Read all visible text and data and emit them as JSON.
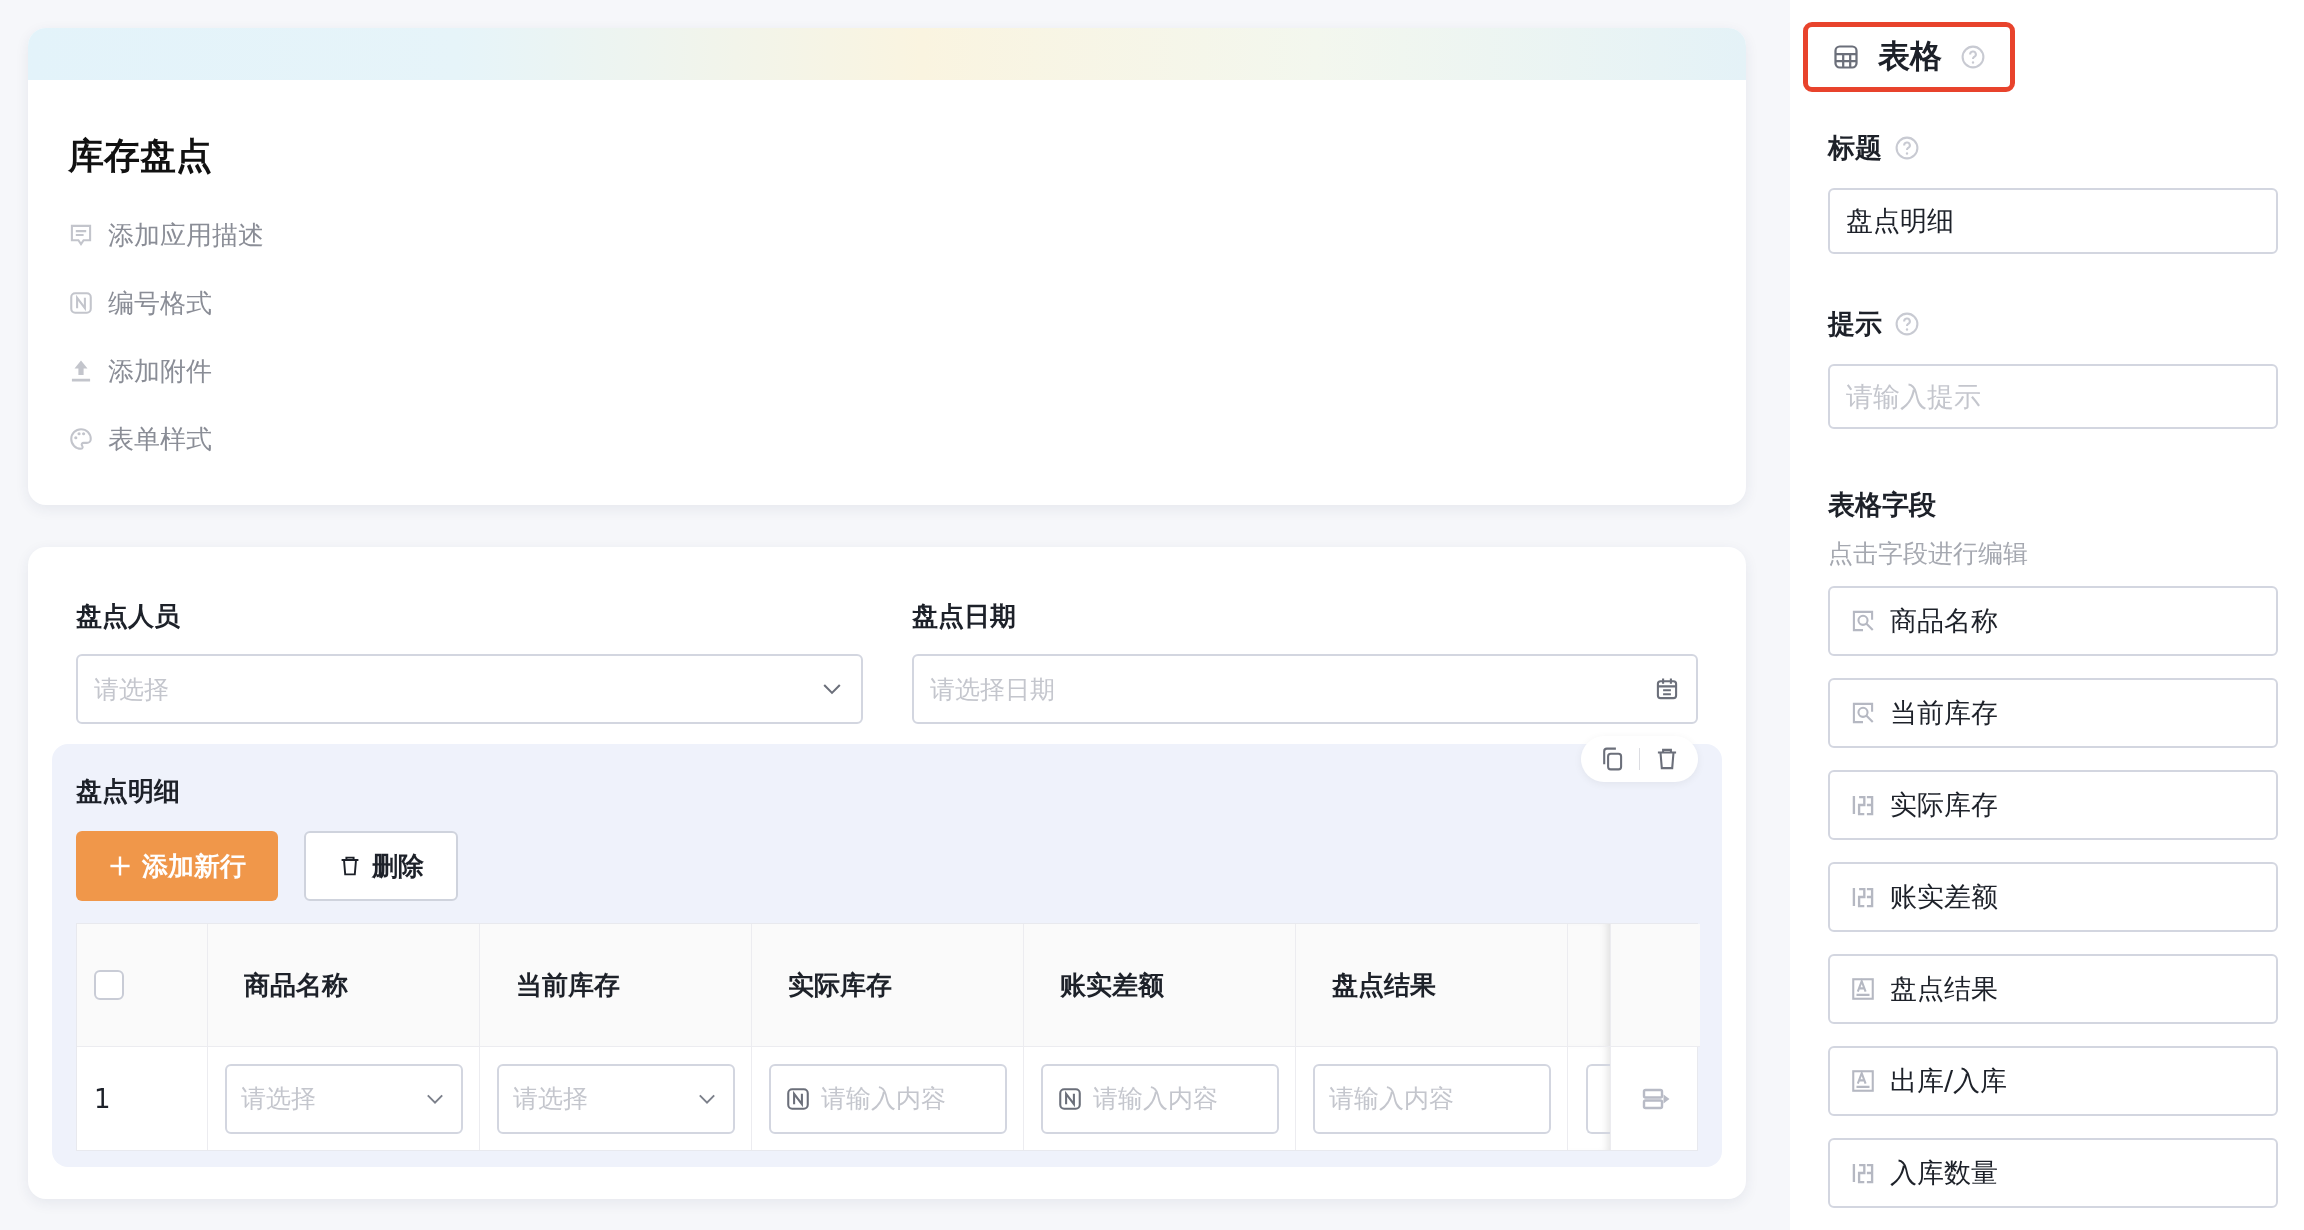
{
  "app": {
    "title": "库存盘点",
    "actions": [
      {
        "kind": "description",
        "label": "添加应用描述"
      },
      {
        "kind": "numbering",
        "label": "编号格式"
      },
      {
        "kind": "attachment",
        "label": "添加附件"
      },
      {
        "kind": "style",
        "label": "表单样式"
      }
    ]
  },
  "form": {
    "fields": [
      {
        "kind": "select",
        "label": "盘点人员",
        "placeholder": "请选择"
      },
      {
        "kind": "date",
        "label": "盘点日期",
        "placeholder": "请选择日期"
      }
    ],
    "subtable": {
      "title": "盘点明细",
      "header_checked": false,
      "buttons": [
        {
          "kind": "primary",
          "label": "添加新行"
        },
        {
          "kind": "default",
          "label": "删除"
        }
      ],
      "columns": [
        {
          "label": "商品名称"
        },
        {
          "label": "当前库存"
        },
        {
          "label": "实际库存"
        },
        {
          "label": "账实差额"
        },
        {
          "label": "盘点结果"
        },
        {
          "cut": true
        }
      ],
      "rows": [
        {
          "index": "1",
          "cells": [
            {
              "kind": "select",
              "placeholder": "请选择"
            },
            {
              "kind": "select",
              "placeholder": "请选择"
            },
            {
              "kind": "number",
              "placeholder": "请输入内容"
            },
            {
              "kind": "number",
              "placeholder": "请输入内容"
            },
            {
              "kind": "text",
              "placeholder": "请输入内容"
            },
            {
              "kind": "text",
              "cut": true
            }
          ]
        }
      ]
    }
  },
  "panel": {
    "title": "表格",
    "title_label": "标题",
    "title_value": "盘点明细",
    "hint_label": "提示",
    "hint_placeholder": "请输入提示",
    "fields_heading": "表格字段",
    "fields_hint": "点击字段进行编辑",
    "fields": [
      {
        "kind": "lookup",
        "label": "商品名称"
      },
      {
        "kind": "lookup",
        "label": "当前库存"
      },
      {
        "kind": "number",
        "label": "实际库存"
      },
      {
        "kind": "number",
        "label": "账实差额"
      },
      {
        "kind": "text",
        "label": "盘点结果"
      },
      {
        "kind": "text",
        "label": "出库/入库"
      },
      {
        "kind": "number",
        "label": "入库数量"
      }
    ]
  }
}
